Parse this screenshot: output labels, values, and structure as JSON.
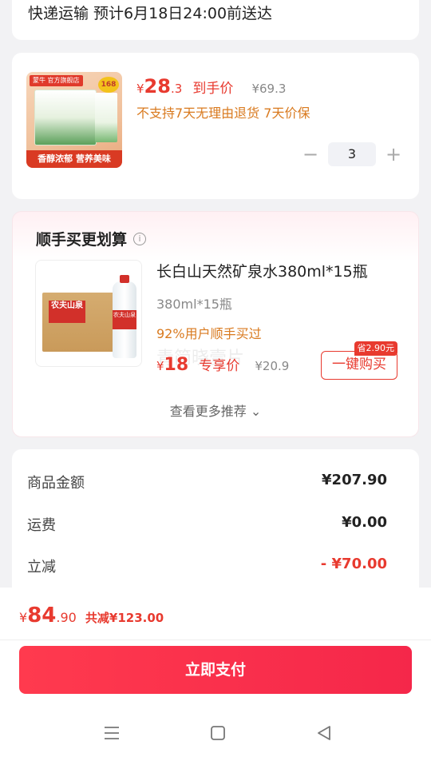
{
  "delivery": {
    "text": "快递运输 预计6月18日24:00前送达"
  },
  "product": {
    "image_texts": {
      "brand": "蒙牛 官方旗舰店",
      "badge": "168",
      "bottom": "香醇浓郁 营养美味"
    },
    "yen": "¥",
    "price_int": "28",
    "price_dec": ".3",
    "price_tag": "到手价",
    "orig_price": "¥69.3",
    "policy": "不支持7天无理由退货 7天价保",
    "quantity": "3",
    "minus": "−",
    "plus": "+"
  },
  "recommend": {
    "title": "顺手买更划算",
    "info_icon": "i",
    "image_texts": {
      "carton": "农夫山泉",
      "bottle": "农夫山泉"
    },
    "name": "长白山天然矿泉水380ml*15瓶",
    "spec": "380ml*15瓶",
    "buy_rate": "92%用户顺手买过",
    "yen": "¥",
    "price": "18",
    "price_tag": "专享价",
    "orig_price": "¥20.9",
    "save_tag": "省2.90元",
    "buy_label": "一键购买",
    "watermark": "青简晓壹片",
    "more_label": "查看更多推荐",
    "more_chevron": "⌄"
  },
  "summary": {
    "rows": [
      {
        "key": "商品金额",
        "value": "¥207.90",
        "color": "#222222"
      },
      {
        "key": "运费",
        "value": "¥0.00",
        "color": "#222222"
      },
      {
        "key": "立减",
        "value": "- ¥70.00",
        "color": "#e83a2f"
      }
    ]
  },
  "bottom": {
    "yen": "¥",
    "total_int": "84",
    "total_dec": ".90",
    "saved": "共减¥123.00",
    "pay_label": "立即支付",
    "nav_icons": [
      "menu-icon",
      "home-square-icon",
      "back-triangle-icon"
    ]
  },
  "colors": {
    "accent": "#e83a2f",
    "pay_gradient_start": "#ff3a4e",
    "pay_gradient_end": "#f5274a",
    "orange": "#d97a1f"
  }
}
